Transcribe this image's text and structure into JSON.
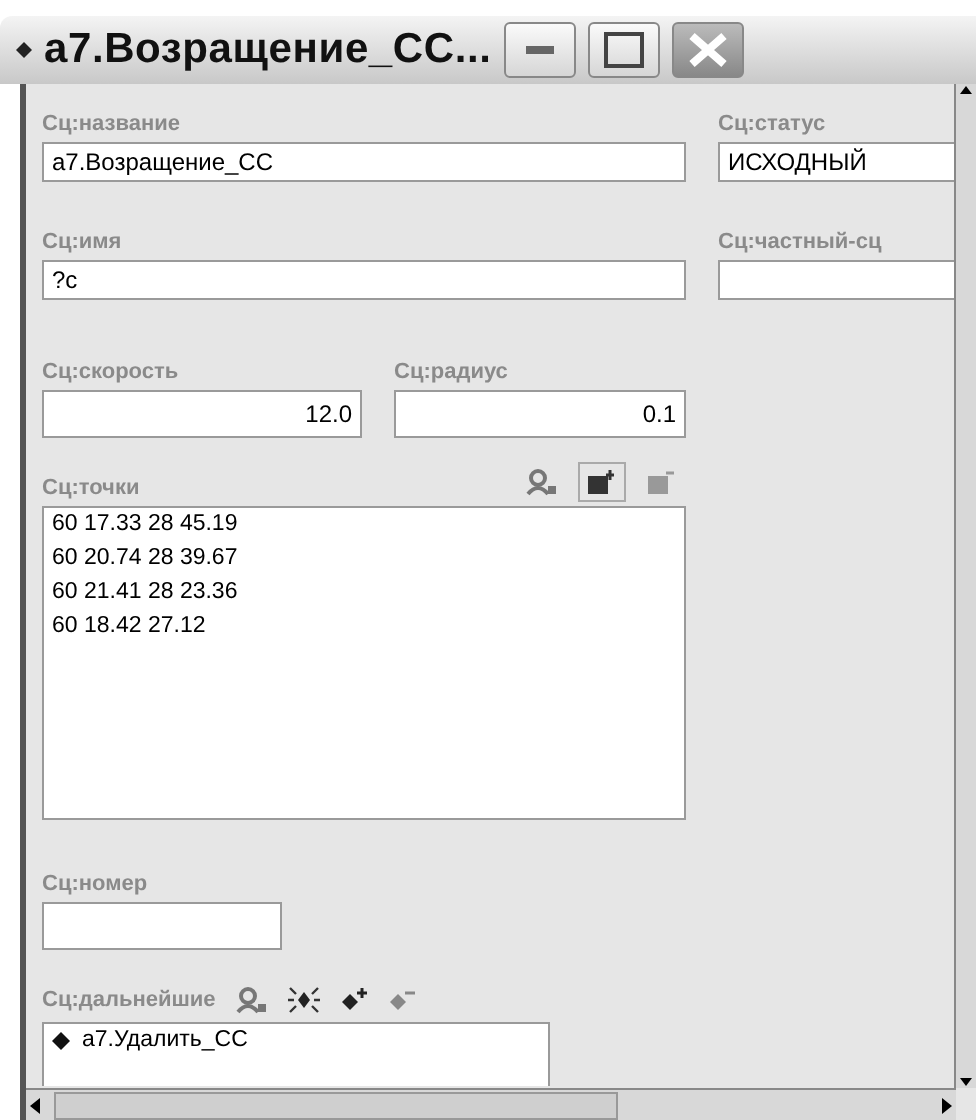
{
  "window": {
    "title": "a7.Возращение_СС..."
  },
  "fields": [
    {
      "label": "Сц:название",
      "value": "а7.Возращение_СС"
    },
    {
      "label": "Сц:статус",
      "value": "ИСХОДНЫЙ"
    },
    {
      "label": "Сц:имя",
      "value": "?c"
    },
    {
      "label": "Сц:частный-сц"
    }
  ],
  "speed": {
    "label": "Сц:скорость",
    "value": "12.0"
  },
  "radius": {
    "label": "Сц:радиус",
    "value": "0.1"
  },
  "points": {
    "label": "Сц:точки",
    "items": [
      "60 17.33 28 45.19",
      "60 20.74 28 39.67",
      "60 21.41 28 23.36",
      "60 18.42 27.12"
    ]
  },
  "number": {
    "label": "Сц:номер"
  },
  "next": {
    "label": "Сц:дальнейшие",
    "items": [
      "а7.Удалить_СС"
    ]
  }
}
